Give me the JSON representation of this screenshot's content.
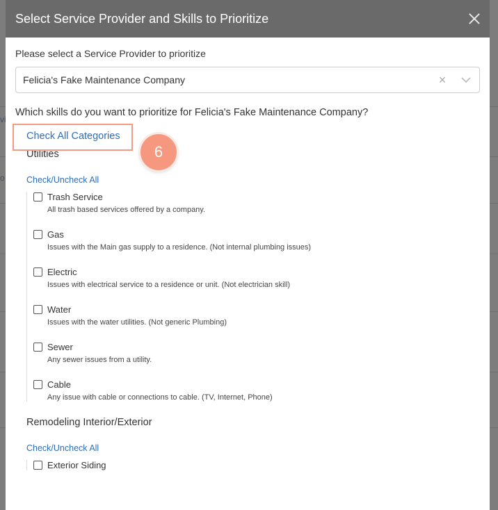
{
  "modal": {
    "title": "Select Service Provider and Skills to Prioritize",
    "provider_label": "Please select a Service Provider to prioritize",
    "provider_value": "Felicia's Fake Maintenance Company",
    "question": "Which skills do you want to prioritize for Felicia's Fake Maintenance Company?",
    "check_all_label": "Check All Categories",
    "step_number": "6"
  },
  "categories": [
    {
      "title": "Utilities",
      "toggle_label": "Check/Uncheck All",
      "skills": [
        {
          "name": "Trash Service",
          "description": "All trash based services offered by a company."
        },
        {
          "name": "Gas",
          "description": "Issues with the Main gas supply to a residence. (Not internal plumbing issues)"
        },
        {
          "name": "Electric",
          "description": "Issues with electrical service to a residence or unit. (Not electrician skill)"
        },
        {
          "name": "Water",
          "description": "Issues with the water utilities. (Not generic Plumbing)"
        },
        {
          "name": "Sewer",
          "description": "Any sewer issues from a utility."
        },
        {
          "name": "Cable",
          "description": "Any issue with cable or connections to cable. (TV, Internet, Phone)"
        }
      ]
    },
    {
      "title": "Remodeling Interior/Exterior",
      "toggle_label": "Check/Uncheck All",
      "skills": [
        {
          "name": "Exterior Siding",
          "description": ""
        }
      ]
    }
  ],
  "colors": {
    "header_bg": "#6a6a6a",
    "link": "#2e6db4",
    "highlight": "#f39a86",
    "badge": "#f5987f"
  },
  "background": {
    "glyph_1": "vi",
    "glyph_2": "o"
  }
}
